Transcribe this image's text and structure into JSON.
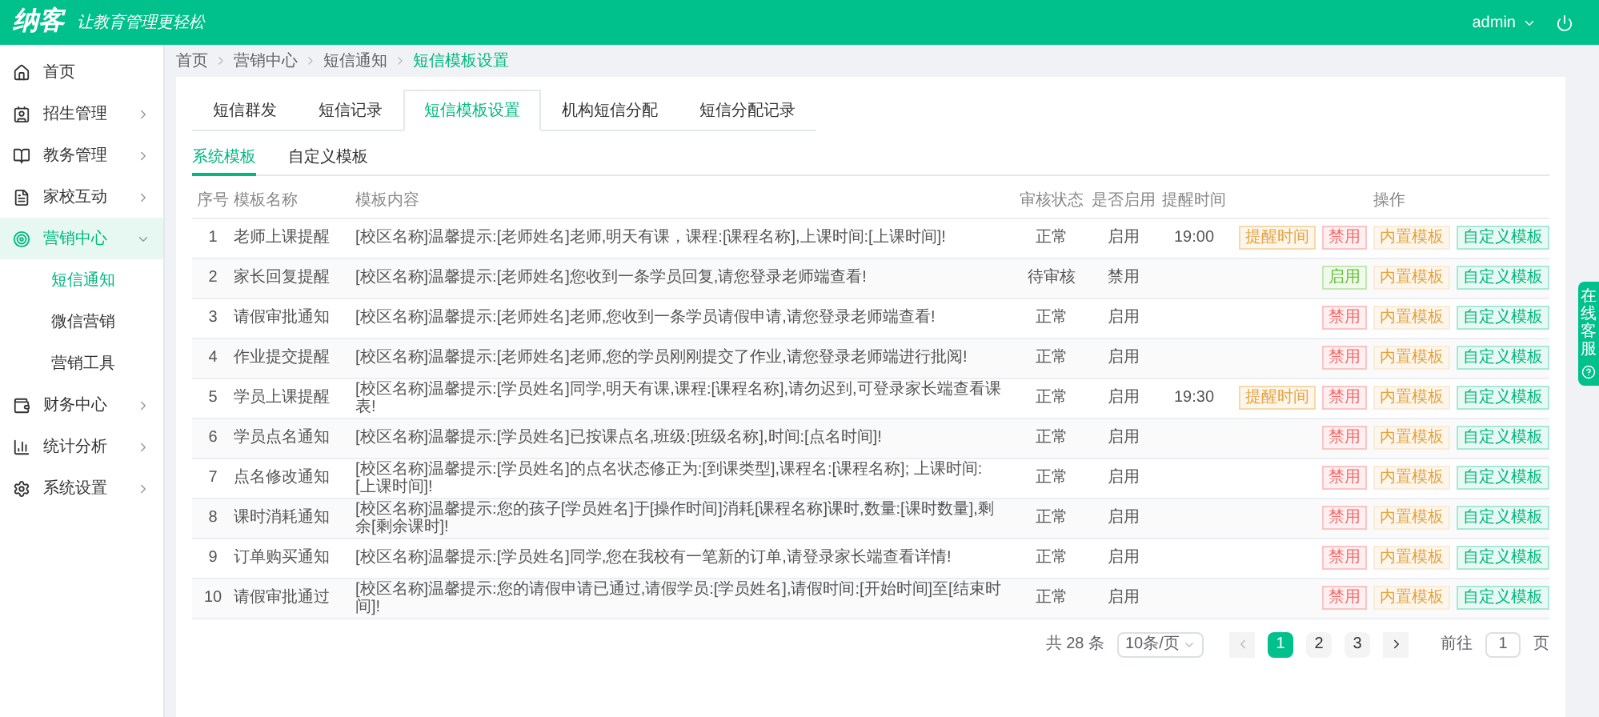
{
  "header": {
    "logo": "纳客",
    "slogan": "让教育管理更轻松",
    "user": "admin"
  },
  "sidebar": {
    "items": [
      {
        "label": "首页",
        "selected": false
      },
      {
        "label": "招生管理",
        "selected": false,
        "expanded": false
      },
      {
        "label": "教务管理",
        "selected": false,
        "expanded": false
      },
      {
        "label": "家校互动",
        "selected": false,
        "expanded": false
      },
      {
        "label": "营销中心",
        "selected": true,
        "expanded": true,
        "children": [
          {
            "label": "短信通知",
            "selected": true
          },
          {
            "label": "微信营销",
            "selected": false
          },
          {
            "label": "营销工具",
            "selected": false
          }
        ]
      },
      {
        "label": "财务中心",
        "selected": false,
        "expanded": false
      },
      {
        "label": "统计分析",
        "selected": false,
        "expanded": false
      },
      {
        "label": "系统设置",
        "selected": false,
        "expanded": false
      }
    ]
  },
  "breadcrumb": [
    "首页",
    "营销中心",
    "短信通知",
    "短信模板设置"
  ],
  "tabs": [
    {
      "label": "短信群发",
      "selected": false
    },
    {
      "label": "短信记录",
      "selected": false
    },
    {
      "label": "短信模板设置",
      "selected": true
    },
    {
      "label": "机构短信分配",
      "selected": false
    },
    {
      "label": "短信分配记录",
      "selected": false
    }
  ],
  "subtabs": [
    {
      "label": "系统模板",
      "selected": true
    },
    {
      "label": "自定义模板",
      "selected": false
    }
  ],
  "table": {
    "columns": [
      "序号",
      "模板名称",
      "模板内容",
      "审核状态",
      "是否启用",
      "提醒时间",
      "操作"
    ],
    "rows": [
      {
        "no": "1",
        "name": "老师上课提醒",
        "content": "[校区名称]温馨提示:[老师姓名]老师,明天有课，课程:[课程名称],上课时间:[上课时间]!",
        "status": "正常",
        "enabled": "启用",
        "time": "19:00",
        "actions": [
          {
            "label": "提醒时间",
            "kind": "time"
          },
          {
            "label": "禁用",
            "kind": "disable"
          },
          {
            "label": "内置模板",
            "kind": "builtin"
          },
          {
            "label": "自定义模板",
            "kind": "custom"
          }
        ]
      },
      {
        "no": "2",
        "name": "家长回复提醒",
        "content": "[校区名称]温馨提示:[老师姓名]您收到一条学员回复,请您登录老师端查看!",
        "status": "待审核",
        "enabled": "禁用",
        "actions": [
          {
            "label": "启用",
            "kind": "enable"
          },
          {
            "label": "内置模板",
            "kind": "builtin"
          },
          {
            "label": "自定义模板",
            "kind": "custom"
          }
        ]
      },
      {
        "no": "3",
        "name": "请假审批通知",
        "content": "[校区名称]温馨提示:[老师姓名]老师,您收到一条学员请假申请,请您登录老师端查看!",
        "status": "正常",
        "enabled": "启用",
        "actions": [
          {
            "label": "禁用",
            "kind": "disable"
          },
          {
            "label": "内置模板",
            "kind": "builtin"
          },
          {
            "label": "自定义模板",
            "kind": "custom"
          }
        ]
      },
      {
        "no": "4",
        "name": "作业提交提醒",
        "content": "[校区名称]温馨提示:[老师姓名]老师,您的学员刚刚提交了作业,请您登录老师端进行批阅!",
        "status": "正常",
        "enabled": "启用",
        "actions": [
          {
            "label": "禁用",
            "kind": "disable"
          },
          {
            "label": "内置模板",
            "kind": "builtin"
          },
          {
            "label": "自定义模板",
            "kind": "custom"
          }
        ]
      },
      {
        "no": "5",
        "name": "学员上课提醒",
        "content": "[校区名称]温馨提示:[学员姓名]同学,明天有课,课程:[课程名称],请勿迟到,可登录家长端查看课表!",
        "status": "正常",
        "enabled": "启用",
        "time": "19:30",
        "actions": [
          {
            "label": "提醒时间",
            "kind": "time"
          },
          {
            "label": "禁用",
            "kind": "disable"
          },
          {
            "label": "内置模板",
            "kind": "builtin"
          },
          {
            "label": "自定义模板",
            "kind": "custom"
          }
        ]
      },
      {
        "no": "6",
        "name": "学员点名通知",
        "content": "[校区名称]温馨提示:[学员姓名]已按课点名,班级:[班级名称],时间:[点名时间]!",
        "status": "正常",
        "enabled": "启用",
        "actions": [
          {
            "label": "禁用",
            "kind": "disable"
          },
          {
            "label": "内置模板",
            "kind": "builtin"
          },
          {
            "label": "自定义模板",
            "kind": "custom"
          }
        ]
      },
      {
        "no": "7",
        "name": "点名修改通知",
        "content": "[校区名称]温馨提示:[学员姓名]的点名状态修正为:[到课类型],课程名:[课程名称]; 上课时间:[上课时间]!",
        "status": "正常",
        "enabled": "启用",
        "actions": [
          {
            "label": "禁用",
            "kind": "disable"
          },
          {
            "label": "内置模板",
            "kind": "builtin"
          },
          {
            "label": "自定义模板",
            "kind": "custom"
          }
        ]
      },
      {
        "no": "8",
        "name": "课时消耗通知",
        "content": "[校区名称]温馨提示:您的孩子[学员姓名]于[操作时间]消耗[课程名称]课时,数量:[课时数量],剩余[剩余课时]!",
        "status": "正常",
        "enabled": "启用",
        "actions": [
          {
            "label": "禁用",
            "kind": "disable"
          },
          {
            "label": "内置模板",
            "kind": "builtin"
          },
          {
            "label": "自定义模板",
            "kind": "custom"
          }
        ]
      },
      {
        "no": "9",
        "name": "订单购买通知",
        "content": "[校区名称]温馨提示:[学员姓名]同学,您在我校有一笔新的订单,请登录家长端查看详情!",
        "status": "正常",
        "enabled": "启用",
        "actions": [
          {
            "label": "禁用",
            "kind": "disable"
          },
          {
            "label": "内置模板",
            "kind": "builtin"
          },
          {
            "label": "自定义模板",
            "kind": "custom"
          }
        ]
      },
      {
        "no": "10",
        "name": "请假审批通过",
        "content": "[校区名称]温馨提示:您的请假申请已通过,请假学员:[学员姓名],请假时间:[开始时间]至[结束时间]!",
        "status": "正常",
        "enabled": "启用",
        "actions": [
          {
            "label": "禁用",
            "kind": "disable"
          },
          {
            "label": "内置模板",
            "kind": "builtin"
          },
          {
            "label": "自定义模板",
            "kind": "custom"
          }
        ]
      }
    ]
  },
  "pagination": {
    "total": "共 28 条",
    "page_size": "10条/页",
    "pages": [
      {
        "label": "1",
        "selected": true
      },
      {
        "label": "2",
        "selected": false
      },
      {
        "label": "3",
        "selected": false
      }
    ],
    "goto_label": "前往",
    "goto_value": "1",
    "goto_unit": "页"
  },
  "side_tab": {
    "label": "在线客服"
  }
}
